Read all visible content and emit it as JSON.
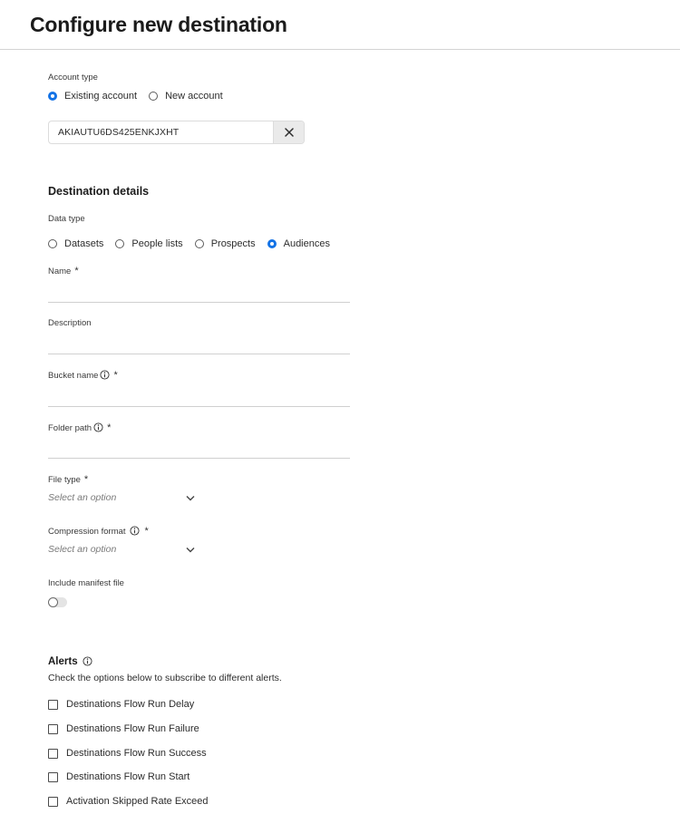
{
  "header": {
    "title": "Configure new destination"
  },
  "account": {
    "type_label": "Account type",
    "options": [
      {
        "label": "Existing account",
        "checked": true
      },
      {
        "label": "New account",
        "checked": false
      }
    ],
    "access_key": "AKIAUTU6DS425ENKJXHT",
    "clear_icon": "close-icon"
  },
  "destination": {
    "section_title": "Destination details",
    "data_type_label": "Data type",
    "data_types": [
      {
        "label": "Datasets",
        "checked": false
      },
      {
        "label": "People lists",
        "checked": false
      },
      {
        "label": "Prospects",
        "checked": false
      },
      {
        "label": "Audiences",
        "checked": true
      }
    ],
    "name_label": "Name",
    "description_label": "Description",
    "bucket_label": "Bucket name",
    "folder_label": "Folder path",
    "file_type_label": "File type",
    "file_type_placeholder": "Select an option",
    "compression_label": "Compression format",
    "compression_placeholder": "Select an option",
    "manifest_label": "Include manifest file",
    "manifest_enabled": false,
    "required_marker": "*"
  },
  "alerts": {
    "title": "Alerts",
    "description": "Check the options below to subscribe to different alerts.",
    "items": [
      {
        "label": "Destinations Flow Run Delay",
        "checked": false
      },
      {
        "label": "Destinations Flow Run Failure",
        "checked": false
      },
      {
        "label": "Destinations Flow Run Success",
        "checked": false
      },
      {
        "label": "Destinations Flow Run Start",
        "checked": false
      },
      {
        "label": "Activation Skipped Rate Exceed",
        "checked": false
      }
    ]
  },
  "colors": {
    "accent": "#1473e6",
    "divider": "#d4d4d4"
  }
}
